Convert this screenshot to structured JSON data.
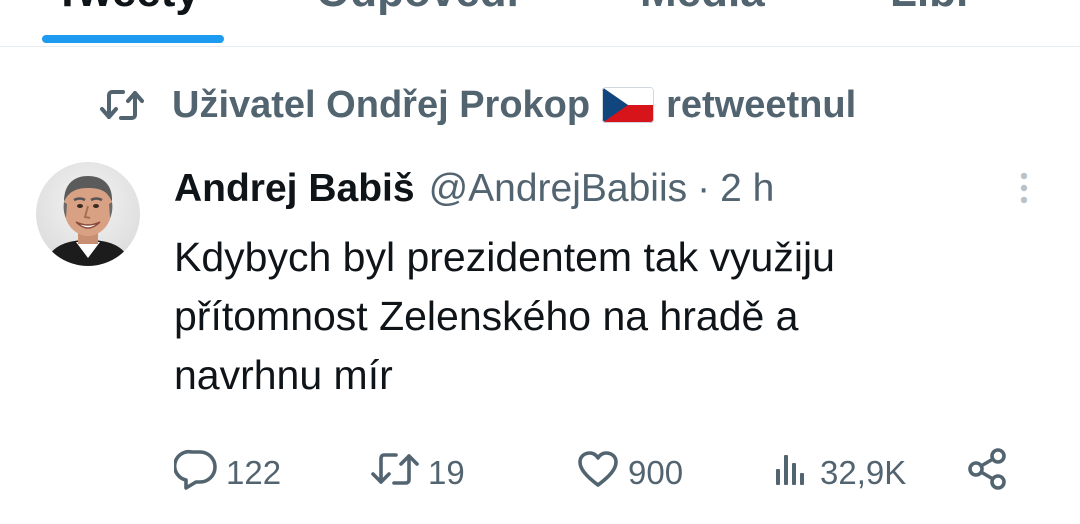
{
  "tabs": {
    "items": [
      {
        "label": "Tweety"
      },
      {
        "label": "Odpovědi"
      },
      {
        "label": "Média"
      },
      {
        "label": "Líbí"
      }
    ]
  },
  "retweet": {
    "prefix": "Uživatel Ondřej Prokop",
    "suffix": "retweetnul",
    "flag": "czech-flag"
  },
  "tweet": {
    "author_name": "Andrej Babiš",
    "author_handle": "@AndrejBabiis",
    "separator": "·",
    "time": "2 h",
    "text": "Kdybych byl prezidentem tak využiju\npřítomnost Zelenského na hradě a\nnavrhnu mír",
    "actions": {
      "replies": "122",
      "retweets": "19",
      "likes": "900",
      "views": "32,9K"
    }
  },
  "colors": {
    "accent": "#1d9bf0",
    "muted_text": "#536471",
    "main_text": "#0f1419"
  }
}
